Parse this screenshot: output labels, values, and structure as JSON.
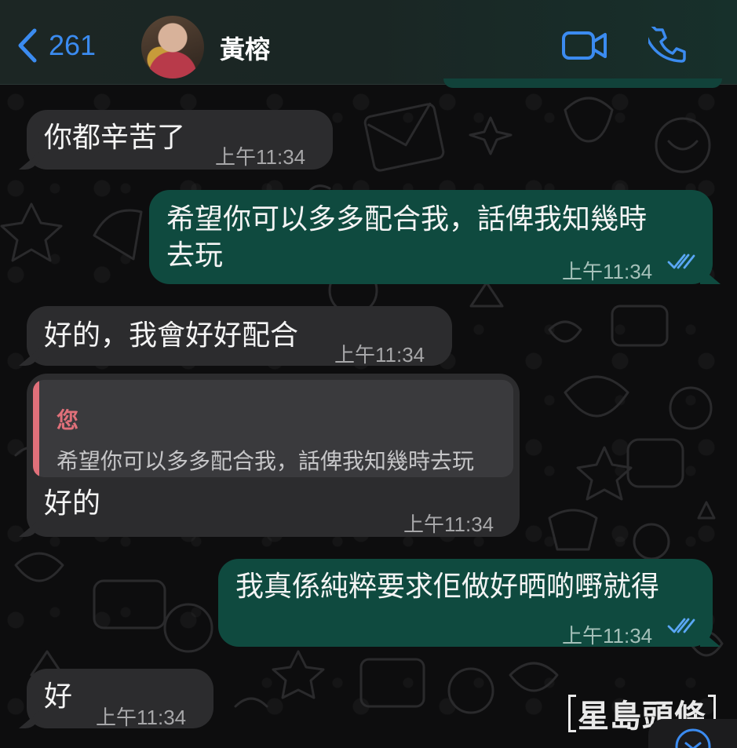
{
  "header": {
    "back_count": "261",
    "contact_name": "黃榕"
  },
  "messages": [
    {
      "direction": "incoming",
      "text": "你都辛苦了",
      "time": "上午11:34"
    },
    {
      "direction": "outgoing",
      "text_line1": "希望你可以多多配合我，話俾我知幾時",
      "text_line2": "去玩",
      "time": "上午11:34",
      "status": "read"
    },
    {
      "direction": "incoming",
      "text": "好的，我會好好配合",
      "time": "上午11:34"
    },
    {
      "direction": "incoming",
      "reply_to": {
        "author": "您",
        "text": "希望你可以多多配合我，話俾我知幾時去玩"
      },
      "text": "好的",
      "time": "上午11:34"
    },
    {
      "direction": "outgoing",
      "text": "我真係純粹要求佢做好晒啲嘢就得",
      "time": "上午11:34",
      "status": "read"
    },
    {
      "direction": "incoming",
      "text": "好",
      "time": "上午11:34"
    }
  ],
  "watermark": "星島頭條",
  "colors": {
    "accent_blue": "#3b8bf0",
    "incoming_bubble": "#2c2c2e",
    "outgoing_bubble": "#0f4a3f",
    "read_ticks": "#5aa7f5",
    "quote_accent": "#e0707a"
  },
  "icons": {
    "back": "chevron-left-icon",
    "video": "video-camera-icon",
    "call": "phone-icon",
    "read": "double-check-icon",
    "scroll": "chevron-down-icon"
  }
}
